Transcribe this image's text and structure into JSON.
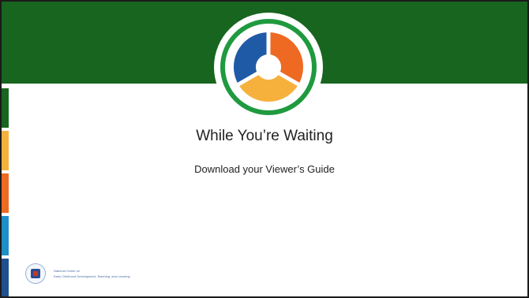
{
  "slide": {
    "title": "While You’re Waiting",
    "subtitle": "Download your Viewer’s Guide"
  },
  "footer": {
    "org_line_1": "National Center on",
    "org_line_2": "Early Childhood Development, Teaching, and Learning"
  },
  "colors": {
    "header_green": "#17651f",
    "ring_green": "#1f9a3f",
    "segment_blue": "#1f5aa6",
    "segment_orange": "#ee6a22",
    "segment_yellow": "#f6b13d",
    "stripe_green": "#17651f",
    "stripe_yellow": "#f6b13d",
    "stripe_orange": "#ee6a22",
    "stripe_blue": "#1f8fc7",
    "stripe_navy": "#1f4f8f"
  },
  "icons": {
    "logo": "ring-logo-icon",
    "seal": "seal-icon"
  }
}
